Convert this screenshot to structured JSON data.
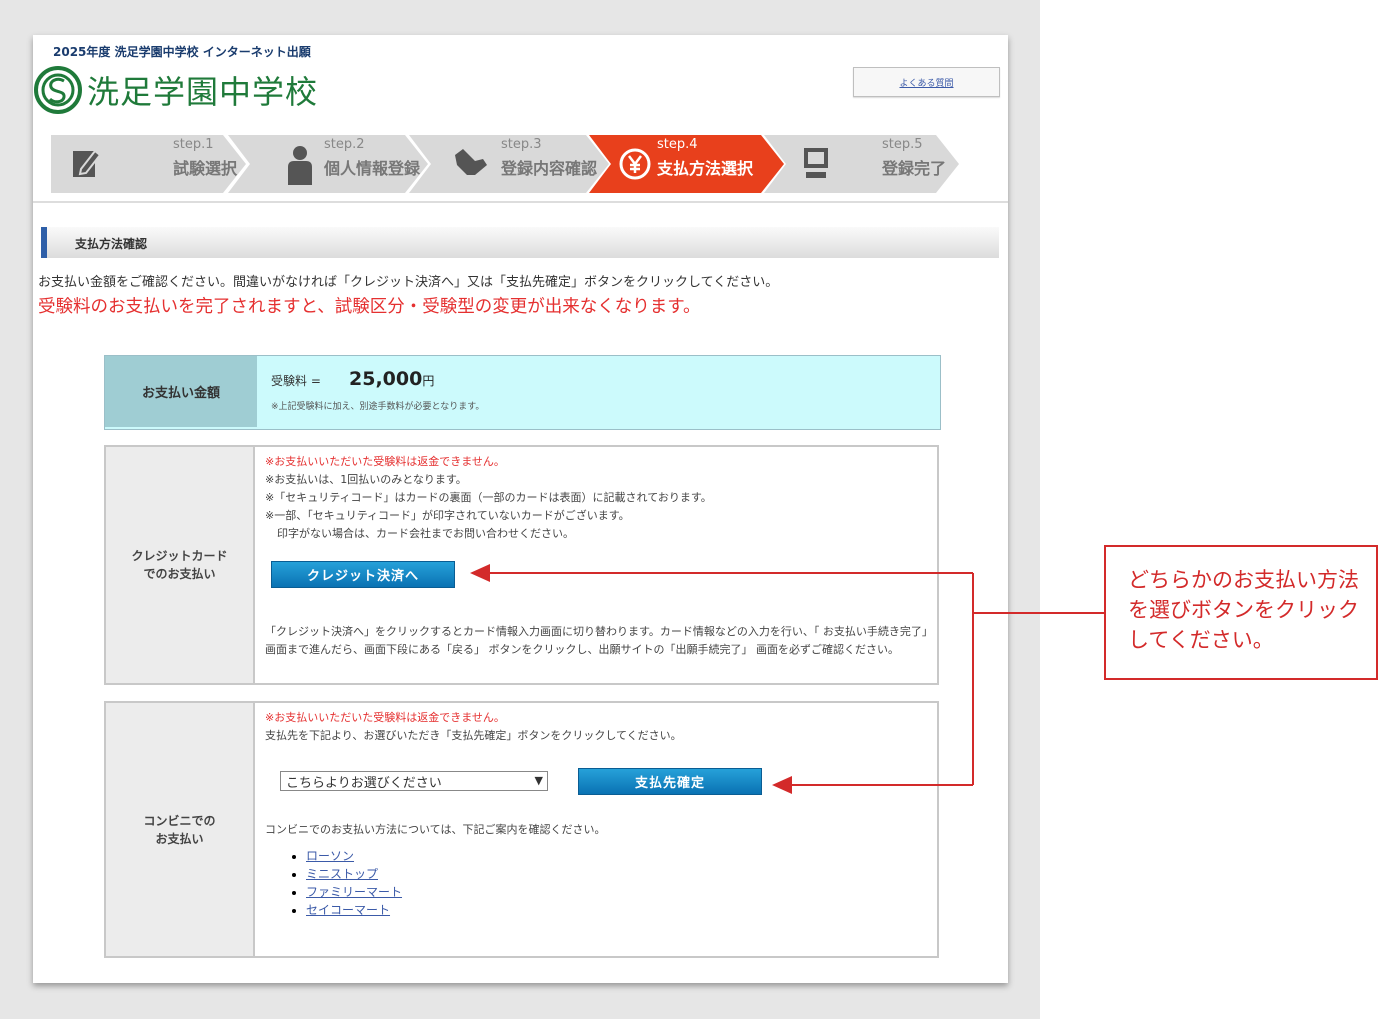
{
  "header": {
    "top_title": "2025年度 洗足学園中学校 インターネット出願",
    "school_name": "洗足学園中学校",
    "faq_link": "よくある質問"
  },
  "steps": [
    {
      "num": "step.1",
      "label": "試験選択",
      "icon": "pen-icon",
      "active": false
    },
    {
      "num": "step.2",
      "label": "個人情報登録",
      "icon": "person-icon",
      "active": false
    },
    {
      "num": "step.3",
      "label": "登録内容確認",
      "icon": "hand-icon",
      "active": false
    },
    {
      "num": "step.4",
      "label": "支払方法選択",
      "icon": "yen-icon",
      "active": true
    },
    {
      "num": "step.5",
      "label": "登録完了",
      "icon": "monitor-icon",
      "active": false
    }
  ],
  "section": {
    "title": "支払方法確認",
    "intro": "お支払い金額をご確認ください。間違いがなければ「クレジット決済へ」又は「支払先確定」ボタンをクリックしてください。",
    "warning": "受験料のお支払いを完了されますと、試験区分・受験型の変更が出来なくなります。"
  },
  "amount": {
    "label": "お支払い金額",
    "fee_label": "受験料 =",
    "fee_value": "25,000",
    "fee_unit": "円",
    "fee_note": "※上記受験料に加え、別途手数料が必要となります。"
  },
  "credit": {
    "label_line1": "クレジットカード",
    "label_line2": "でのお支払い",
    "note_refund": "※お支払いいただいた受験料は返金できません。",
    "note_once": "※お支払いは、1回払いのみとなります。",
    "note_security": "※「セキュリティコード」はカードの裏面（一部のカードは表面）に記載されております。",
    "note_partial": "※一部、「セキュリティコード」が印字されていないカードがございます。",
    "note_contact": "印字がない場合は、カード会社までお問い合わせください。",
    "button": "クレジット決済へ",
    "description": "「クレジット決済へ」をクリックするとカード情報入力画面に切り替わります。カード情報などの入力を行い、「 お支払い手続き完了」画面まで進んだら、画面下段にある「戻る」 ボタンをクリックし、出願サイトの「出願手続完了」 画面を必ずご確認ください。"
  },
  "convenience": {
    "label_line1": "コンビニでの",
    "label_line2": "お支払い",
    "note_refund": "※お支払いいただいた受験料は返金できません。",
    "note_select": "支払先を下記より、お選びいただき「支払先確定」ボタンをクリックしてください。",
    "select_value": "こちらよりお選びください",
    "button": "支払先確定",
    "guide": "コンビニでのお支払い方法については、下記ご案内を確認ください。",
    "stores": [
      "ローソン",
      "ミニストップ",
      "ファミリーマート",
      "セイコーマート"
    ]
  },
  "callout": {
    "text": "どちらかのお支払い方法を選びボタンをクリックしてください。"
  },
  "colors": {
    "active_step": "#e8401c",
    "inactive_step": "#d9d9d9",
    "warning_red": "#e53030",
    "button_blue": "#0a72b3",
    "callout_red": "#d32a2a",
    "brand_green": "#1f7a3a"
  }
}
